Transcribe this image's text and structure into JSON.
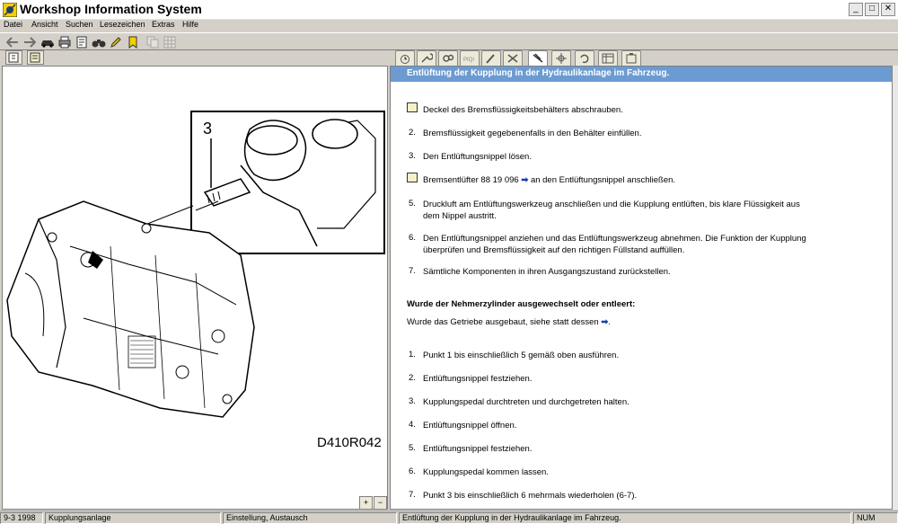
{
  "window": {
    "title": "Workshop Information System",
    "min": "_",
    "max": "□",
    "close": "✕"
  },
  "menu": [
    "Datei",
    "Ansicht",
    "Suchen",
    "Lesezeichen",
    "Extras",
    "Hilfe"
  ],
  "toolbar_icons": [
    "back-arrow-icon",
    "forward-arrow-icon",
    "car-icon",
    "print-icon",
    "document-icon",
    "binoculars-icon",
    "pen-icon",
    "bookmark-icon",
    "copy-icon",
    "grid-icon"
  ],
  "tab_icons": [
    "alarm-clock-icon",
    "wrench-icon",
    "gears-icon",
    "piqi-icon",
    "pencil-icon",
    "tools-icon",
    "crosshair-icon",
    "undo-icon",
    "table-icon",
    "clipboard-icon"
  ],
  "figure": {
    "callout_number": "3",
    "code": "D410R042",
    "zoom_in": "+",
    "zoom_out": "−"
  },
  "document": {
    "title": "Entlüftung der Kupplung in der Hydraulikanlage im Fahrzeug.",
    "steps": [
      {
        "num": "",
        "icon": true,
        "text": "Deckel des Bremsflüssigkeitsbehälters abschrauben."
      },
      {
        "num": "2.",
        "text": "Bremsflüssigkeit gegebenenfalls in den Behälter einfüllen."
      },
      {
        "num": "3.",
        "text": "Den Entlüftungsnippel lösen."
      },
      {
        "num": "",
        "icon": true,
        "text": "Bremsentlüfter 88 19 096",
        "text_after": "an den Entlüftungsnippel anschließen."
      },
      {
        "num": "5.",
        "text": "Druckluft am Entlüftungswerkzeug anschließen und die Kupplung entlüften, bis klare Flüssigkeit aus",
        "line2": "dem Nippel austritt."
      },
      {
        "num": "6.",
        "text": "Den Entlüftungsnippel anziehen und das Entlüftungswerkzeug abnehmen. Die Funktion der Kupplung",
        "line2": "überprüfen und Bremsflüssigkeit auf den richtigen Füllstand auffüllen."
      },
      {
        "num": "7.",
        "text": "Sämtliche Komponenten in ihren Ausgangszustand zurückstellen."
      }
    ],
    "subheading": "Wurde der Nehmerzylinder ausgewechselt oder entleert:",
    "note": "Wurde das Getriebe ausgebaut, siehe statt dessen",
    "note_end": ".",
    "steps2": [
      {
        "num": "1.",
        "text": "Punkt 1 bis einschließlich 5 gemäß oben ausführen."
      },
      {
        "num": "2.",
        "text": "Entlüftungsnippel festziehen."
      },
      {
        "num": "3.",
        "text": "Kupplungspedal durchtreten und durchgetreten halten."
      },
      {
        "num": "4.",
        "text": "Entlüftungsnippel öffnen."
      },
      {
        "num": "5.",
        "text": "Entlüftungsnippel festziehen."
      },
      {
        "num": "6.",
        "text": "Kupplungspedal kommen lassen."
      },
      {
        "num": "7.",
        "text": "Punkt 3 bis einschließlich 6 mehrmals wiederholen (6-7)."
      }
    ]
  },
  "status": {
    "model": "9-3 1998",
    "group": "Kupplungsanlage",
    "category": "Einstellung, Austausch",
    "topic": "Entlüftung der Kupplung in der Hydraulikanlage im Fahrzeug.",
    "numlock": "NUM"
  },
  "colors": {
    "title_bar_blue": "#6b9bd1",
    "arrow_blue": "#1b3fa0",
    "chrome": "#d4d0c8"
  }
}
